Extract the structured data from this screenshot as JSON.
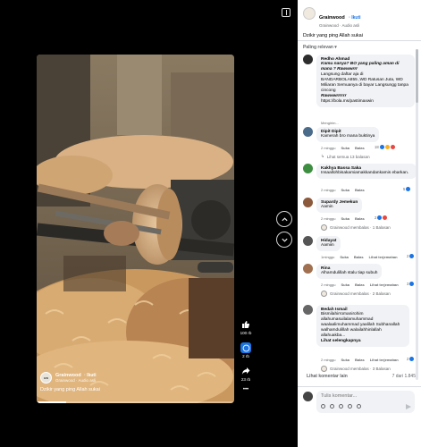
{
  "post": {
    "page_name": "Grainwood",
    "follow_label": "· Ikuti",
    "audio": "Grainwood · Audio asli",
    "caption": "Dzikir yang ping Allah sukai"
  },
  "video_overlay": {
    "page_name": "Grainwood",
    "follow_label": "· Ikuti",
    "audio": "Grainwood · Audio asli",
    "caption": "Dzikir yang ping Allah sukai"
  },
  "actions": {
    "likes": "100 rb",
    "comments": "2 rb",
    "shares": "23 rb",
    "more": "•••"
  },
  "comments_panel": {
    "sort_label": "Paling relevan ▾",
    "items": [
      {
        "name": "Redho Ahmad",
        "line1": "Kamu nanya? BO yang paling aman di mana ? Rawwwrrr",
        "line2": "Langsung daftar aja di",
        "line3": "BANDARBOLA855 ,WD Ratusan Juta, WD Miliaran Semuanya di bayar Langsungg tanpa cincong",
        "line4": "Rawwwrrrrrr",
        "line5": "https://bola.ms/pastimaxwin",
        "meta": "Mengirim..."
      },
      {
        "name": "Dipit Dipit",
        "text": "Kamerah bro mana buktinya",
        "time": "2 minggu",
        "like": "Suka",
        "reply": "Balas",
        "reacts": "18",
        "replies": "Lihat semua 13 balasan"
      },
      {
        "name": "Kakhya Bassa Saka",
        "text": "Insaallohbisakamiamakkandankamis ebarkan.",
        "time": "2 minggu",
        "like": "Suka",
        "reply": "Balas",
        "reacts": "5"
      },
      {
        "name": "Supardy Jemekun",
        "text": "Aamin",
        "time": "2 minggu",
        "like": "Suka",
        "reply": "Balas",
        "reacts": "2",
        "replies": "Grainwood membalas · 1 Balasan"
      },
      {
        "name": "Hidayat",
        "text": "Aamiin",
        "time": "1minggu",
        "like": "Suka",
        "reply": "Balas",
        "extra": "Lihat terjemahan",
        "reacts": "2"
      },
      {
        "name": "Rina",
        "text": "Alhamdulillah stalu tiap subuh",
        "time": "2 minggu",
        "like": "Suka",
        "reply": "Balas",
        "extra": "Lihat terjemahan",
        "reacts": "3",
        "replies": "Grainwood membalas · 2 Balasan"
      },
      {
        "name": "Bedah Ismail",
        "text": "Bismilahirromanirohim allahumasuilalamuhammad waalaalimuhammad yaalilah Subhanallah walhamdulillah walailahhinlallah allahuakba...",
        "see_more": "Lihat selengkapnya",
        "time": "2 minggu",
        "like": "Suka",
        "reply": "Balas",
        "extra": "Lihat terjemahan",
        "reacts": "2",
        "replies": "Grainwood membalas · 3 Balasan"
      }
    ],
    "more_label": "Lihat komentar lain",
    "count_label": "7 dari 1.845",
    "composer_placeholder": "Tulis komentar..."
  },
  "colors": {
    "accent": "#1b74e4",
    "panel_bg": "#ffffff",
    "bubble_bg": "#f0f2f5"
  }
}
